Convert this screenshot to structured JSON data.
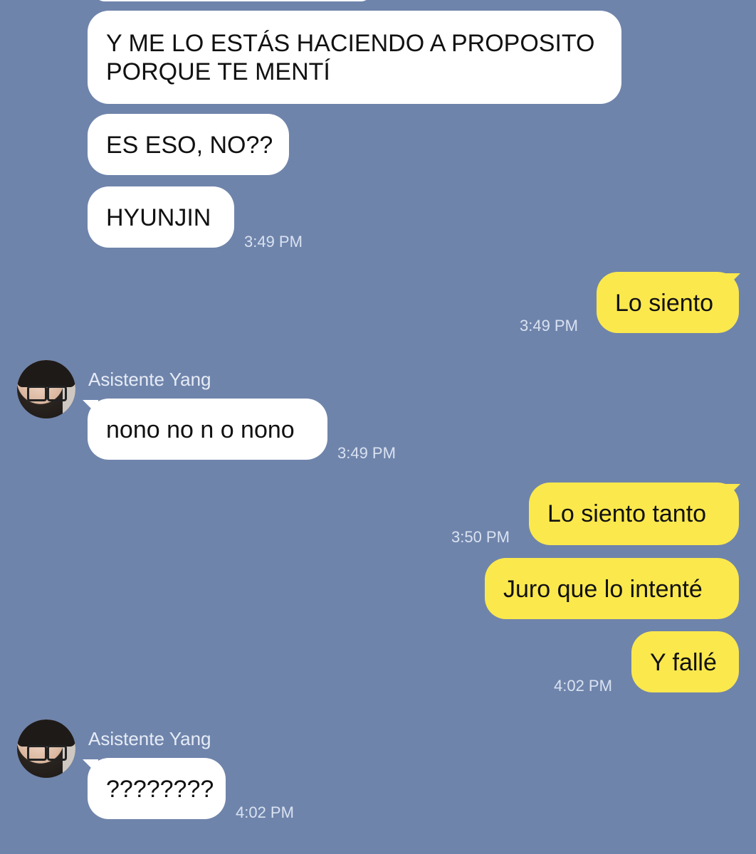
{
  "messages": {
    "m1": {
      "text_line1": "Y ME LO ESTÁS HACIENDO A PROPOSITO",
      "text_line2": "PORQUE TE MENTÍ"
    },
    "m2": {
      "text": "ES ESO, NO??"
    },
    "m3": {
      "text": "HYUNJIN",
      "time": "3:49 PM"
    },
    "m4": {
      "text": "Lo siento",
      "time": "3:49 PM"
    },
    "m5": {
      "sender": "Asistente Yang",
      "text": "nono no n o nono",
      "time": "3:49 PM"
    },
    "m6": {
      "text": "Lo siento tanto",
      "time": "3:50 PM"
    },
    "m7": {
      "text": "Juro que lo intenté"
    },
    "m8": {
      "text": "Y fallé",
      "time": "4:02 PM"
    },
    "m9": {
      "sender": "Asistente Yang",
      "text": "????????",
      "time": "4:02 PM"
    }
  },
  "colors": {
    "background": "#6f84ab",
    "incoming_bubble": "#ffffff",
    "outgoing_bubble": "#fbe84d"
  },
  "icons": [
    "avatar-asistente-yang"
  ]
}
